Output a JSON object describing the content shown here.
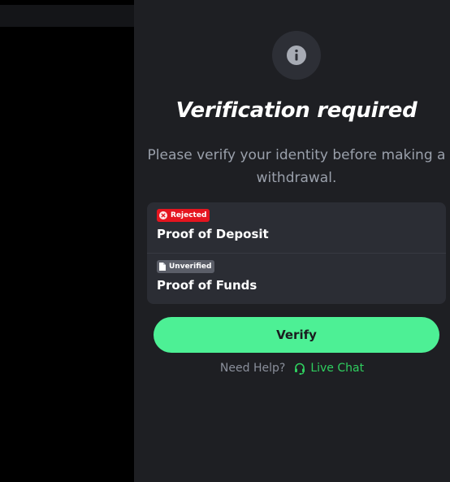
{
  "modal": {
    "title": "Verification required",
    "subtitle": "Please verify your identity before making a withdrawal.",
    "icon": "info-icon"
  },
  "items": [
    {
      "status": "Rejected",
      "status_icon": "x-circle-icon",
      "status_color": "#e5151f",
      "label": "Proof of Deposit"
    },
    {
      "status": "Unverified",
      "status_icon": "document-icon",
      "status_color": "#5b5e68",
      "label": "Proof of Funds"
    }
  ],
  "verify_button": {
    "label": "Verify",
    "color": "#4df095"
  },
  "help": {
    "text": "Need Help?",
    "link_label": "Live Chat",
    "link_icon": "headset-icon",
    "link_color": "#2fcf5f"
  }
}
